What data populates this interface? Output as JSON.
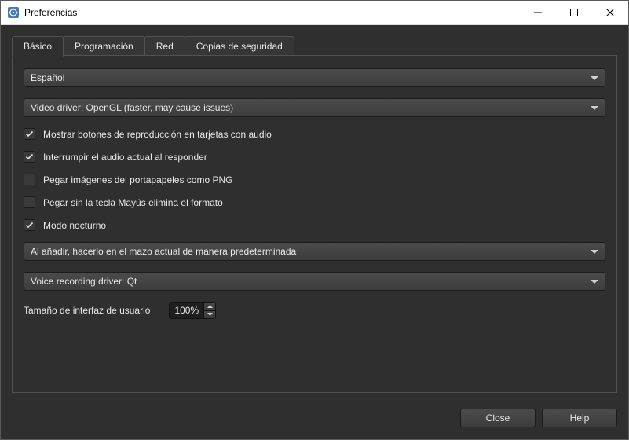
{
  "window": {
    "title": "Preferencias"
  },
  "tabs": {
    "basic": "Básico",
    "scheduling": "Programación",
    "network": "Red",
    "backups": "Copias de seguridad"
  },
  "language_select": {
    "value": "Español"
  },
  "video_driver_select": {
    "value": "Video driver: OpenGL (faster, may cause issues)"
  },
  "checks": {
    "show_play_buttons": {
      "label": "Mostrar botones de reproducción en tarjetas con audio",
      "checked": true
    },
    "interrupt_audio": {
      "label": "Interrumpir el audio actual al responder",
      "checked": true
    },
    "paste_png": {
      "label": "Pegar imágenes del portapapeles como PNG",
      "checked": false
    },
    "paste_shift_strip": {
      "label": "Pegar sin la tecla Mayús elimina el formato",
      "checked": false
    },
    "night_mode": {
      "label": "Modo nocturno",
      "checked": true
    }
  },
  "add_default_deck_select": {
    "value": "Al añadir, hacerlo en el mazo actual de manera predeterminada"
  },
  "voice_driver_select": {
    "value": "Voice recording driver: Qt"
  },
  "ui_size": {
    "label": "Tamaño de interfaz de usuario",
    "value": "100%"
  },
  "buttons": {
    "close": "Close",
    "help": "Help"
  }
}
